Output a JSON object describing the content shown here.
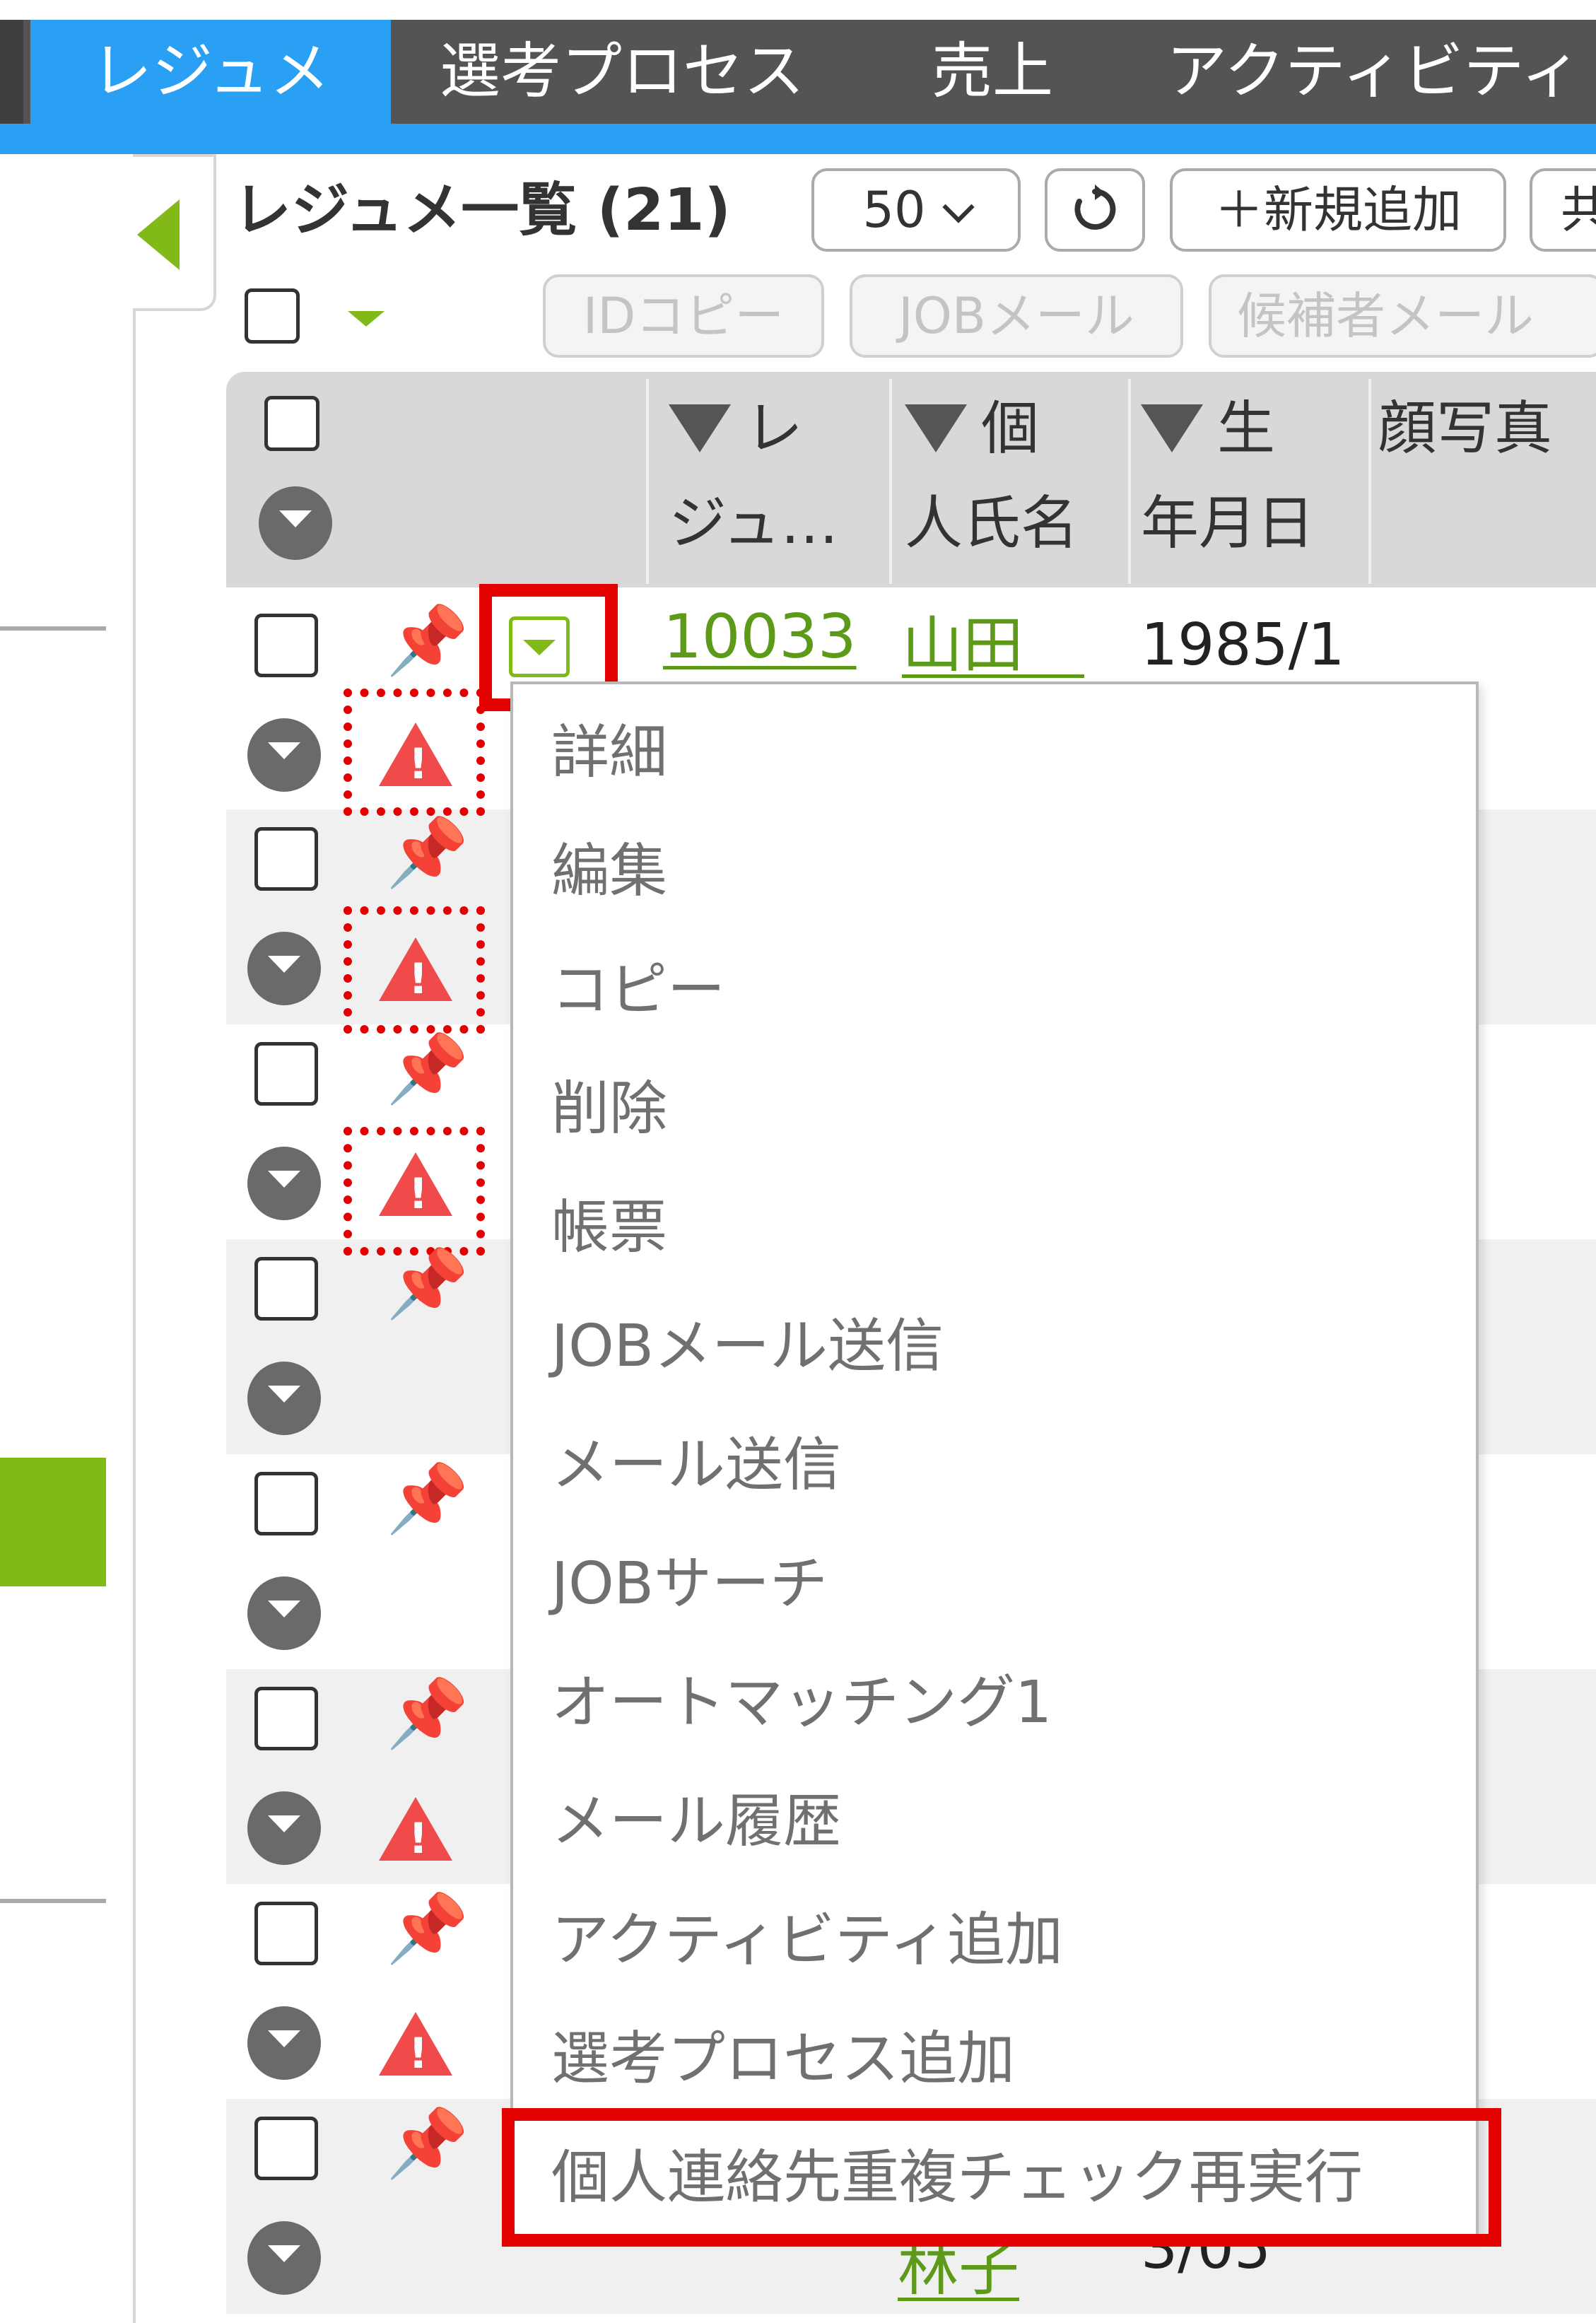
{
  "nav": {
    "tabs": [
      {
        "label": "レジュメ",
        "active": true
      },
      {
        "label": "選考プロセス",
        "active": false
      },
      {
        "label": "売上",
        "active": false
      },
      {
        "label": "アクティビティ",
        "active": false
      }
    ]
  },
  "list": {
    "title": "レジュメ一覧 (21)",
    "page_size": "50",
    "refresh_icon": "refresh-icon",
    "new_button": "＋新規追加",
    "share_button_partial": "共"
  },
  "toolbar": {
    "id_copy": "IDコピー",
    "job_mail": "JOBメール",
    "candidate_mail": "候補者メール"
  },
  "table": {
    "headers": [
      {
        "line1": "レ",
        "line2": "ジュ…",
        "sortable": true
      },
      {
        "line1": "個",
        "line2": "人氏名",
        "sortable": true
      },
      {
        "line1": "生",
        "line2": "年月日",
        "sortable": true
      },
      {
        "line1": "顔写真",
        "line2": "",
        "sortable": false
      }
    ],
    "rows": [
      {
        "resume_id": "10033",
        "name": "山田　",
        "birthdate": "1985/1",
        "warning": true
      },
      {
        "resume_id": "",
        "name": "",
        "birthdate": "",
        "warning": true
      },
      {
        "resume_id": "",
        "name": "",
        "birthdate": "",
        "warning": true
      },
      {
        "resume_id": "",
        "name": "",
        "birthdate": "",
        "warning": false
      },
      {
        "resume_id": "",
        "name": "",
        "birthdate": "",
        "warning": false
      },
      {
        "resume_id": "",
        "name": "",
        "birthdate": "",
        "warning": true
      },
      {
        "resume_id": "",
        "name": "",
        "birthdate": "",
        "warning": true
      },
      {
        "resume_id": "",
        "name": "林子",
        "birthdate": "3/05",
        "warning": false
      }
    ]
  },
  "menu": {
    "items": [
      "詳細",
      "編集",
      "コピー",
      "削除",
      "帳票",
      "JOBメール送信",
      "メール送信",
      "JOBサーチ",
      "オートマッチング1",
      "メール履歴",
      "アクティビティ追加",
      "選考プロセス追加",
      "個人連絡先重複チェック再実行"
    ]
  },
  "colors": {
    "nav_bg": "#545454",
    "nav_active": "#2aa0f5",
    "accent_green": "#80b918",
    "link_green": "#5e9a1a",
    "warning_red": "#f04a4a",
    "highlight_red": "#e30000"
  }
}
